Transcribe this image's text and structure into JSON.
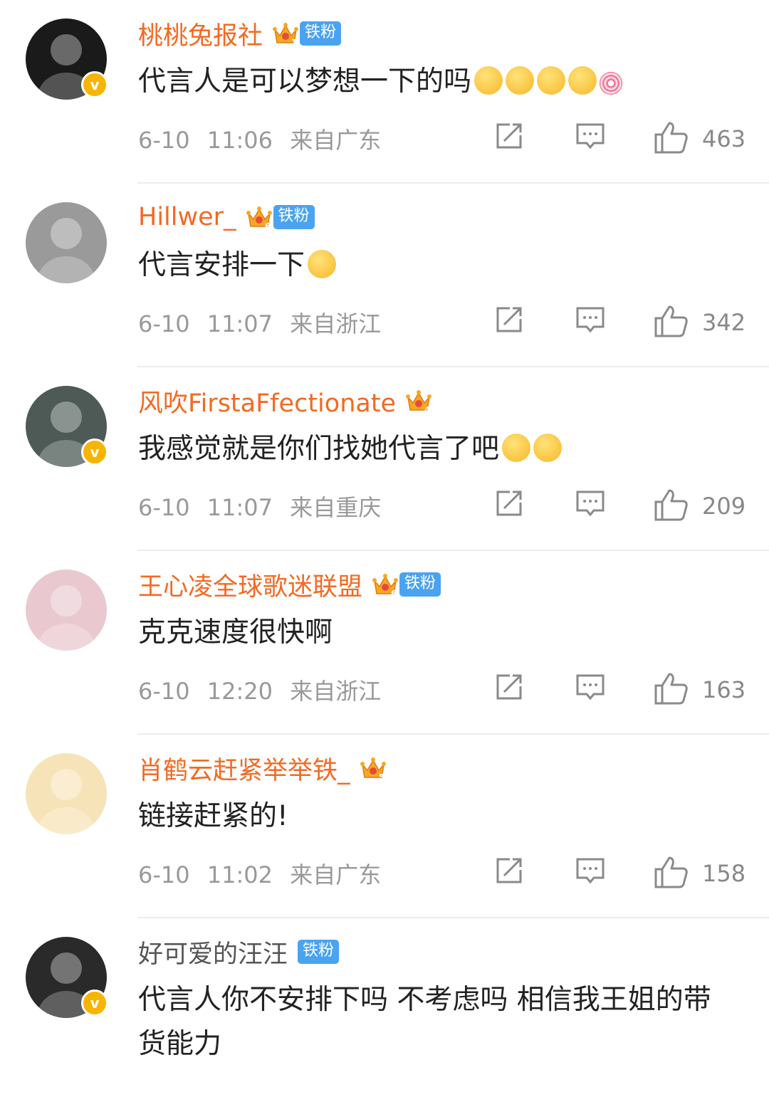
{
  "comments": [
    {
      "name": "桃桃兔报社",
      "crown_level": "1",
      "fan_badge": "铁粉",
      "verified": true,
      "text": "代言人是可以梦想一下的吗",
      "emojis": [
        "face",
        "face",
        "face",
        "face",
        "lolly"
      ],
      "date": "6-10",
      "time": "11:06",
      "location": "来自广东",
      "likes": "463",
      "avatar_color": "#1a1a1a"
    },
    {
      "name": "Hillwer_",
      "crown_level": "6",
      "fan_badge": "铁粉",
      "verified": false,
      "text": "代言安排一下",
      "emojis": [
        "face"
      ],
      "date": "6-10",
      "time": "11:07",
      "location": "来自浙江",
      "likes": "342",
      "avatar_color": "#9a9a9a"
    },
    {
      "name": "风吹FirstaFfectionate",
      "crown_level": "4",
      "fan_badge": "",
      "verified": true,
      "text": "我感觉就是你们找她代言了吧",
      "emojis": [
        "face",
        "face"
      ],
      "date": "6-10",
      "time": "11:07",
      "location": "来自重庆",
      "likes": "209",
      "avatar_color": "#4d5a56"
    },
    {
      "name": "王心凌全球歌迷联盟",
      "crown_level": "6",
      "fan_badge": "铁粉",
      "verified": false,
      "text": "克克速度很快啊",
      "emojis": [],
      "date": "6-10",
      "time": "12:20",
      "location": "来自浙江",
      "likes": "163",
      "avatar_color": "#e9c9cf"
    },
    {
      "name": "肖鹤云赶紧举举铁_",
      "crown_level": "5",
      "fan_badge": "",
      "verified": false,
      "text": "链接赶紧的!",
      "emojis": [],
      "date": "6-10",
      "time": "11:02",
      "location": "来自广东",
      "likes": "158",
      "avatar_color": "#f7e3b8"
    },
    {
      "name": "好可爱的汪汪",
      "crown_level": "",
      "fan_badge": "铁粉",
      "verified": true,
      "text": "代言人你不安排下吗 不考虑吗 相信我王姐的带货能力",
      "emojis": [],
      "date": "",
      "time": "",
      "location": "",
      "likes": "",
      "avatar_color": "#2a2a2a"
    }
  ],
  "colors": {
    "name": "#f26a21",
    "fan_badge": "#4aa3f0",
    "crown": "#f7a823",
    "verified": "#f7b500"
  },
  "icons": {
    "share": "share-icon",
    "reply": "comment-icon",
    "like": "thumbs-up-icon"
  }
}
